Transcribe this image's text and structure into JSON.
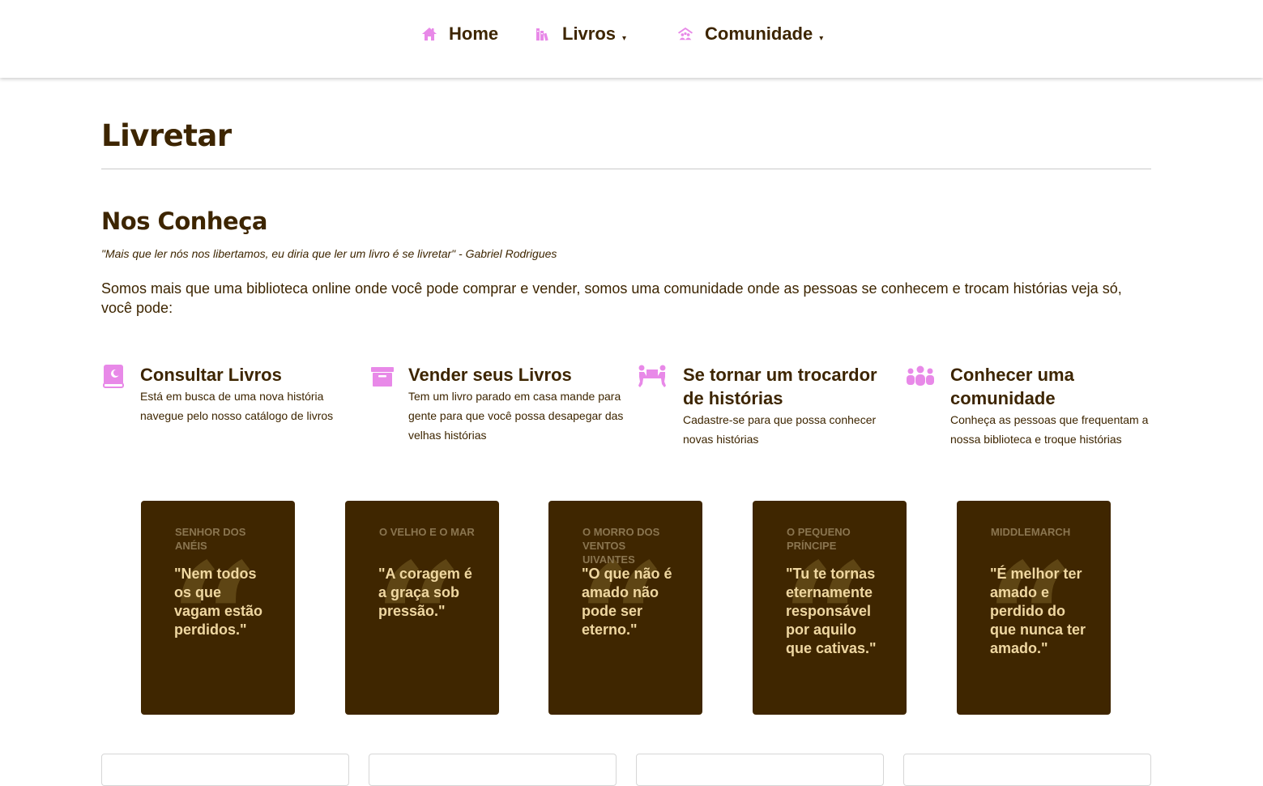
{
  "nav": {
    "home": "Home",
    "livros": "Livros",
    "comunidade": "Comunidade",
    "caret": "▾",
    "icon_color": "#e889e8"
  },
  "header": {
    "title": "Livretar"
  },
  "about": {
    "title": "Nos Conheça",
    "quote": "\"Mais que ler nós nos libertamos, eu diria que ler um livro é se livretar\" - Gabriel Rodrigues",
    "intro": "Somos mais que uma biblioteca online onde você pode comprar e vender, somos uma comunidade onde as pessoas se conhecem e trocam histórias veja só, você pode:"
  },
  "features": [
    {
      "icon": "book-icon",
      "title": "Consultar Livros",
      "desc": "Está em busca de uma nova história navegue pelo nosso catálogo de livros"
    },
    {
      "icon": "archive-icon",
      "title": "Vender seus Livros",
      "desc": "Tem um livro parado em casa mande para gente para que você possa desapegar das velhas histórias"
    },
    {
      "icon": "people-carry-icon",
      "title": "Se tornar um trocardor de histórias",
      "desc": "Cadastre-se para que possa conhecer novas histórias"
    },
    {
      "icon": "users-icon",
      "title": "Conhecer uma comunidade",
      "desc": "Conheça as pessoas que frequentam a nossa biblioteca e troque histórias"
    }
  ],
  "quotes": [
    {
      "book": "Senhor dos Anéis",
      "text": "\"Nem todos os que vagam estão perdidos.\""
    },
    {
      "book": "O Velho e o Mar",
      "text": "\"A coragem é a graça sob pressão.\""
    },
    {
      "book": "O Morro dos Ventos Uivantes",
      "text": "\"O que não é amado não pode ser eterno.\""
    },
    {
      "book": "O Pequeno Príncipe",
      "text": "\"Tu te tornas eternamente responsável por aquilo que cativas.\""
    },
    {
      "book": "Middlemarch",
      "text": "\"É melhor ter amado e perdido do que nunca ter amado.\""
    }
  ],
  "quote_mark": "“",
  "colors": {
    "primary_text": "#3d2500",
    "card_bg": "#3f2600",
    "card_quote_text": "#efd7a1",
    "accent_icon": "#e889e8"
  }
}
